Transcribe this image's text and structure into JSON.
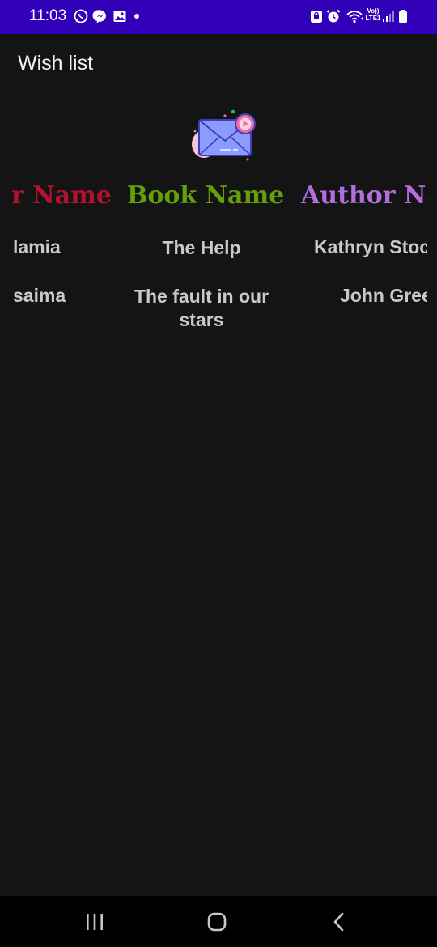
{
  "status_bar": {
    "time": "11:03",
    "icons": [
      "whatsapp-icon",
      "messenger-icon",
      "gallery-icon",
      "dot-icon",
      "lock-icon",
      "alarm-icon",
      "wifi-icon",
      "volte-icon",
      "signal-icon",
      "battery-icon"
    ],
    "network_label_top": "Vo))",
    "network_label_bottom": "LTE1"
  },
  "app_bar": {
    "title": "Wish list"
  },
  "table": {
    "headers": [
      "r Name",
      "Book Name",
      "Author Na"
    ],
    "rows": [
      {
        "user": "lamia",
        "book": "The Help",
        "author": "Kathryn Stoc"
      },
      {
        "user": "saima",
        "book": "The fault in our stars",
        "author": "John Gree"
      }
    ]
  },
  "colors": {
    "status_bar": "#3100b8",
    "background": "#141414",
    "header_user": "#b3122f",
    "header_book": "#62a10b",
    "header_author": "#b06ee0",
    "cell_text": "#c9c9c9"
  },
  "nav_bar": {
    "buttons": [
      "recents-icon",
      "home-icon",
      "back-icon"
    ]
  }
}
